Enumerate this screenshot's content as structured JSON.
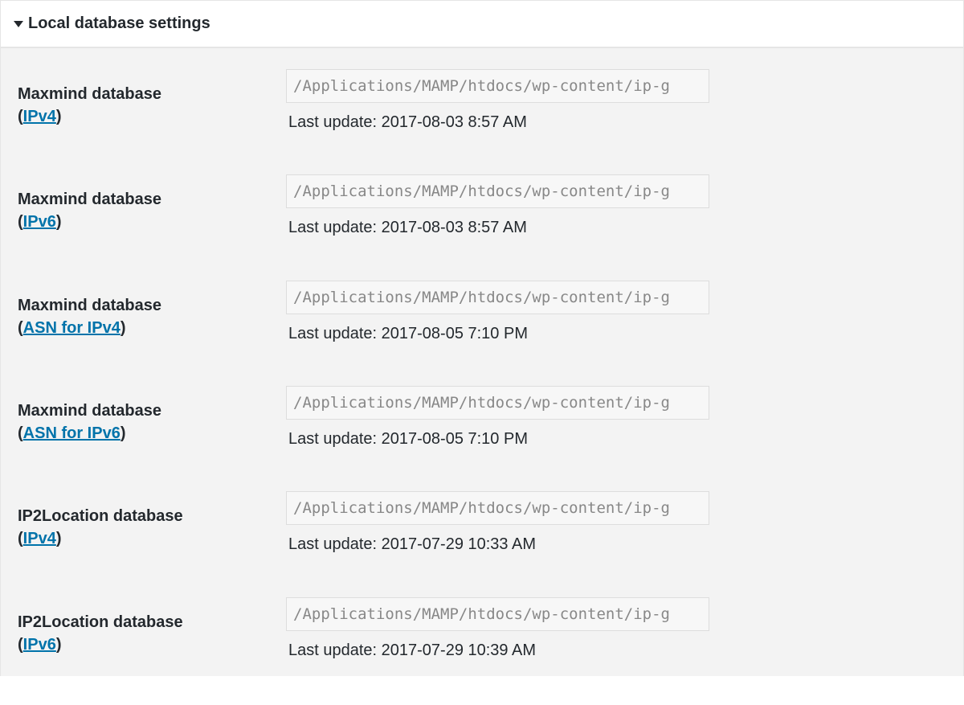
{
  "section": {
    "title": "Local database settings"
  },
  "rows": [
    {
      "label": "Maxmind database",
      "link": "IPv4",
      "path": "/Applications/MAMP/htdocs/wp-content/ip-g",
      "update": "Last update: 2017-08-03 8:57 AM"
    },
    {
      "label": "Maxmind database",
      "link": "IPv6",
      "path": "/Applications/MAMP/htdocs/wp-content/ip-g",
      "update": "Last update: 2017-08-03 8:57 AM"
    },
    {
      "label": "Maxmind database",
      "link": "ASN for IPv4",
      "path": "/Applications/MAMP/htdocs/wp-content/ip-g",
      "update": "Last update: 2017-08-05 7:10 PM"
    },
    {
      "label": "Maxmind database",
      "link": "ASN for IPv6",
      "path": "/Applications/MAMP/htdocs/wp-content/ip-g",
      "update": "Last update: 2017-08-05 7:10 PM"
    },
    {
      "label": "IP2Location database",
      "link": "IPv4",
      "path": "/Applications/MAMP/htdocs/wp-content/ip-g",
      "update": "Last update: 2017-07-29 10:33 AM"
    },
    {
      "label": "IP2Location database",
      "link": "IPv6",
      "path": "/Applications/MAMP/htdocs/wp-content/ip-g",
      "update": "Last update: 2017-07-29 10:39 AM"
    }
  ],
  "paren_open": "(",
  "paren_close": ")"
}
